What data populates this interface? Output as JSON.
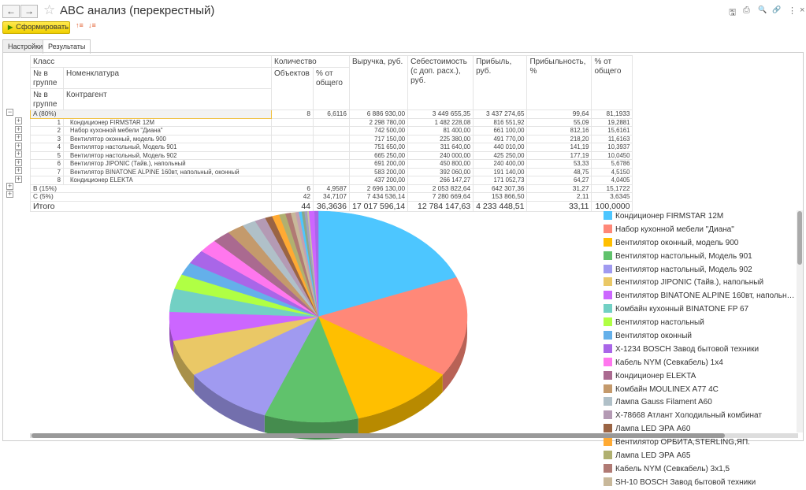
{
  "window": {
    "title": "ABC анализ (перекрестный)",
    "back": "←",
    "forward": "→",
    "star": "☆",
    "icons": [
      "save-icon",
      "print-icon",
      "preview-icon",
      "link-icon",
      "more-icon",
      "close-icon"
    ],
    "icon_glyphs": [
      "🖫",
      "⎙",
      "🔍",
      "🔗",
      "⋮",
      "×"
    ]
  },
  "toolbar": {
    "generate_label": "Сформировать",
    "sort_asc": "↑≡",
    "sort_desc": "↓≡"
  },
  "tabs": [
    {
      "label": "Настройки"
    },
    {
      "label": "Результаты"
    }
  ],
  "table": {
    "headers": {
      "class": "Класс",
      "num_in_group": "№ в группе",
      "nomenclature": "Номенклатура",
      "num_in_group2": "№ в группе",
      "counterparty": "Контрагент",
      "quantity": "Количество",
      "objects": "Объектов",
      "pct_total": "% от общего",
      "revenue": "Выручка, руб.",
      "cost": "Себестоимость (с доп. расх.), руб.",
      "profit": "Прибыль, руб.",
      "profitability": "Прибыльность, %",
      "pct_total2": "% от общего"
    },
    "group_a": {
      "label": "A (80%)",
      "objects": "8",
      "pct": "6,6116",
      "revenue": "6 886 930,00",
      "cost": "3 449 655,35",
      "profit": "3 437 274,65",
      "profitability": "99,64",
      "share": "81,1933"
    },
    "rows": [
      {
        "n": "1",
        "name": "Кондиционер FIRMSTAR 12M",
        "revenue": "2 298 780,00",
        "cost": "1 482 228,08",
        "profit": "816 551,92",
        "profitability": "55,09",
        "share": "19,2881"
      },
      {
        "n": "2",
        "name": "Набор кухонной мебели \"Диана\"",
        "revenue": "742 500,00",
        "cost": "81 400,00",
        "profit": "661 100,00",
        "profitability": "812,16",
        "share": "15,6161"
      },
      {
        "n": "3",
        "name": "Вентилятор оконный, модель 900",
        "revenue": "717 150,00",
        "cost": "225 380,00",
        "profit": "491 770,00",
        "profitability": "218,20",
        "share": "11,6163"
      },
      {
        "n": "4",
        "name": "Вентилятор настольный, Модель 901",
        "revenue": "751 650,00",
        "cost": "311 640,00",
        "profit": "440 010,00",
        "profitability": "141,19",
        "share": "10,3937"
      },
      {
        "n": "5",
        "name": "Вентилятор настольный, Модель 902",
        "revenue": "665 250,00",
        "cost": "240 000,00",
        "profit": "425 250,00",
        "profitability": "177,19",
        "share": "10,0450"
      },
      {
        "n": "6",
        "name": "Вентилятор JIPONIC (Тайв.), напольный",
        "revenue": "691 200,00",
        "cost": "450 800,00",
        "profit": "240 400,00",
        "profitability": "53,33",
        "share": "5,6786"
      },
      {
        "n": "7",
        "name": "Вентилятор BINATONE ALPINE 160вт, напольный, оконный",
        "revenue": "583 200,00",
        "cost": "392 060,00",
        "profit": "191 140,00",
        "profitability": "48,75",
        "share": "4,5150"
      },
      {
        "n": "8",
        "name": "Кондиционер ELEKTA",
        "revenue": "437 200,00",
        "cost": "266 147,27",
        "profit": "171 052,73",
        "profitability": "64,27",
        "share": "4,0405"
      }
    ],
    "group_b": {
      "label": "B (15%)",
      "objects": "6",
      "pct": "4,9587",
      "revenue": "2 696 130,00",
      "cost": "2 053 822,64",
      "profit": "642 307,36",
      "profitability": "31,27",
      "share": "15,1722"
    },
    "group_c": {
      "label": "C (5%)",
      "objects": "42",
      "pct": "34,7107",
      "revenue": "7 434 536,14",
      "cost": "7 280 669,64",
      "profit": "153 866,50",
      "profitability": "2,11",
      "share": "3,6345"
    },
    "total": {
      "label": "Итого",
      "objects": "44",
      "pct": "36,3636",
      "revenue": "17 017 596,14",
      "cost": "12 784 147,63",
      "profit": "4 233 448,51",
      "profitability": "33,11",
      "share": "100,0000"
    }
  },
  "chart_data": {
    "type": "pie",
    "legend_position": "right",
    "legend": [
      {
        "name": "Кондиционер FIRMSTAR 12M",
        "color": "#4dc6ff",
        "value": 19.29
      },
      {
        "name": "Набор кухонной мебели \"Диана\"",
        "color": "#ff8878",
        "value": 15.62
      },
      {
        "name": "Вентилятор оконный, модель 900",
        "color": "#ffbf00",
        "value": 11.62
      },
      {
        "name": "Вентилятор настольный, Модель 901",
        "color": "#60c26c",
        "value": 10.39
      },
      {
        "name": "Вентилятор настольный, Модель 902",
        "color": "#a09af0",
        "value": 10.05
      },
      {
        "name": "Вентилятор JIPONIC (Тайв.), напольный",
        "color": "#eac866",
        "value": 5.68
      },
      {
        "name": "Вентилятор BINATONE ALPINE 160вт, напольный, оконный",
        "color": "#cc66ff",
        "value": 4.52
      },
      {
        "name": "Комбайн кухонный BINATONE FP 67",
        "color": "#72d0c4",
        "value": 3.6
      },
      {
        "name": "Вентилятор настольный",
        "color": "#b0ff44",
        "value": 2.3
      },
      {
        "name": "Вентилятор оконный",
        "color": "#64b0ea",
        "value": 2.0
      },
      {
        "name": "X-1234 BOSCH Завод бытовой техники",
        "color": "#a966e8",
        "value": 2.2
      },
      {
        "name": "Кабель NYM (Севкабель) 1x4",
        "color": "#ff77ee",
        "value": 2.1
      },
      {
        "name": "Кондиционер ELEKTA",
        "color": "#aa6a90",
        "value": 2.0
      },
      {
        "name": "Комбайн MOULINEX  A77 4C",
        "color": "#c49a6c",
        "value": 1.9
      },
      {
        "name": "Лампа Gauss Filament A60",
        "color": "#b0c0c8",
        "value": 1.5
      },
      {
        "name": "X-78668 Атлант Холодильный комбинат",
        "color": "#b49ab4",
        "value": 1.2
      },
      {
        "name": "Лампа LED ЭРА A60",
        "color": "#9a6444",
        "value": 0.8
      },
      {
        "name": "Вентилятор ОРБИТА,STERLING,ЯП.",
        "color": "#ffaa33",
        "value": 0.8
      },
      {
        "name": "Лампа LED ЭРА A65",
        "color": "#b0b070",
        "value": 0.7
      },
      {
        "name": "Кабель NYM (Севкабель) 3x1,5",
        "color": "#b07a74",
        "value": 0.6
      },
      {
        "name": "SH-10 BOSCH Завод бытовой техники",
        "color": "#c8b89a",
        "value": 0.5
      }
    ],
    "others": [
      {
        "color": "#c4a0b0",
        "value": 0.4
      },
      {
        "color": "#4dc6ff",
        "value": 0.3
      },
      {
        "color": "#8aa88a",
        "value": 0.3
      },
      {
        "color": "#a0a0c0",
        "value": 0.3
      },
      {
        "color": "#c8c8a0",
        "value": 0.2
      },
      {
        "color": "#cc66ff",
        "value": 0.6
      },
      {
        "color": "#a966e8",
        "value": 0.4
      }
    ]
  }
}
